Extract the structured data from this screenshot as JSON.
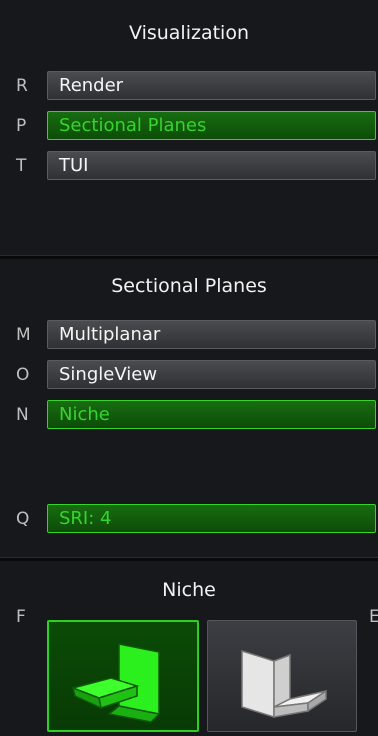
{
  "visualization": {
    "title": "Visualization",
    "items": [
      {
        "key": "R",
        "label": "Render",
        "state": "normal"
      },
      {
        "key": "P",
        "label": "Sectional Planes",
        "state": "selected"
      },
      {
        "key": "T",
        "label": "TUI",
        "state": "normal"
      }
    ]
  },
  "sectional_planes": {
    "title": "Sectional Planes",
    "items": [
      {
        "key": "M",
        "label": "Multiplanar",
        "state": "normal"
      },
      {
        "key": "O",
        "label": "SingleView",
        "state": "normal"
      },
      {
        "key": "N",
        "label": "Niche",
        "state": "selected"
      }
    ],
    "sri": {
      "key": "Q",
      "label": "SRI: 4",
      "state": "selected"
    }
  },
  "niche": {
    "title": "Niche",
    "key_left": "F",
    "key_right": "E",
    "tiles": [
      {
        "icon": "niche-green-icon",
        "state": "selected"
      },
      {
        "icon": "niche-gray-icon",
        "state": "normal"
      }
    ]
  },
  "colors": {
    "accent_green": "#35d52a",
    "selected_bg": "#176d10",
    "button_gray": "#404146",
    "panel_bg": "#17181c"
  }
}
